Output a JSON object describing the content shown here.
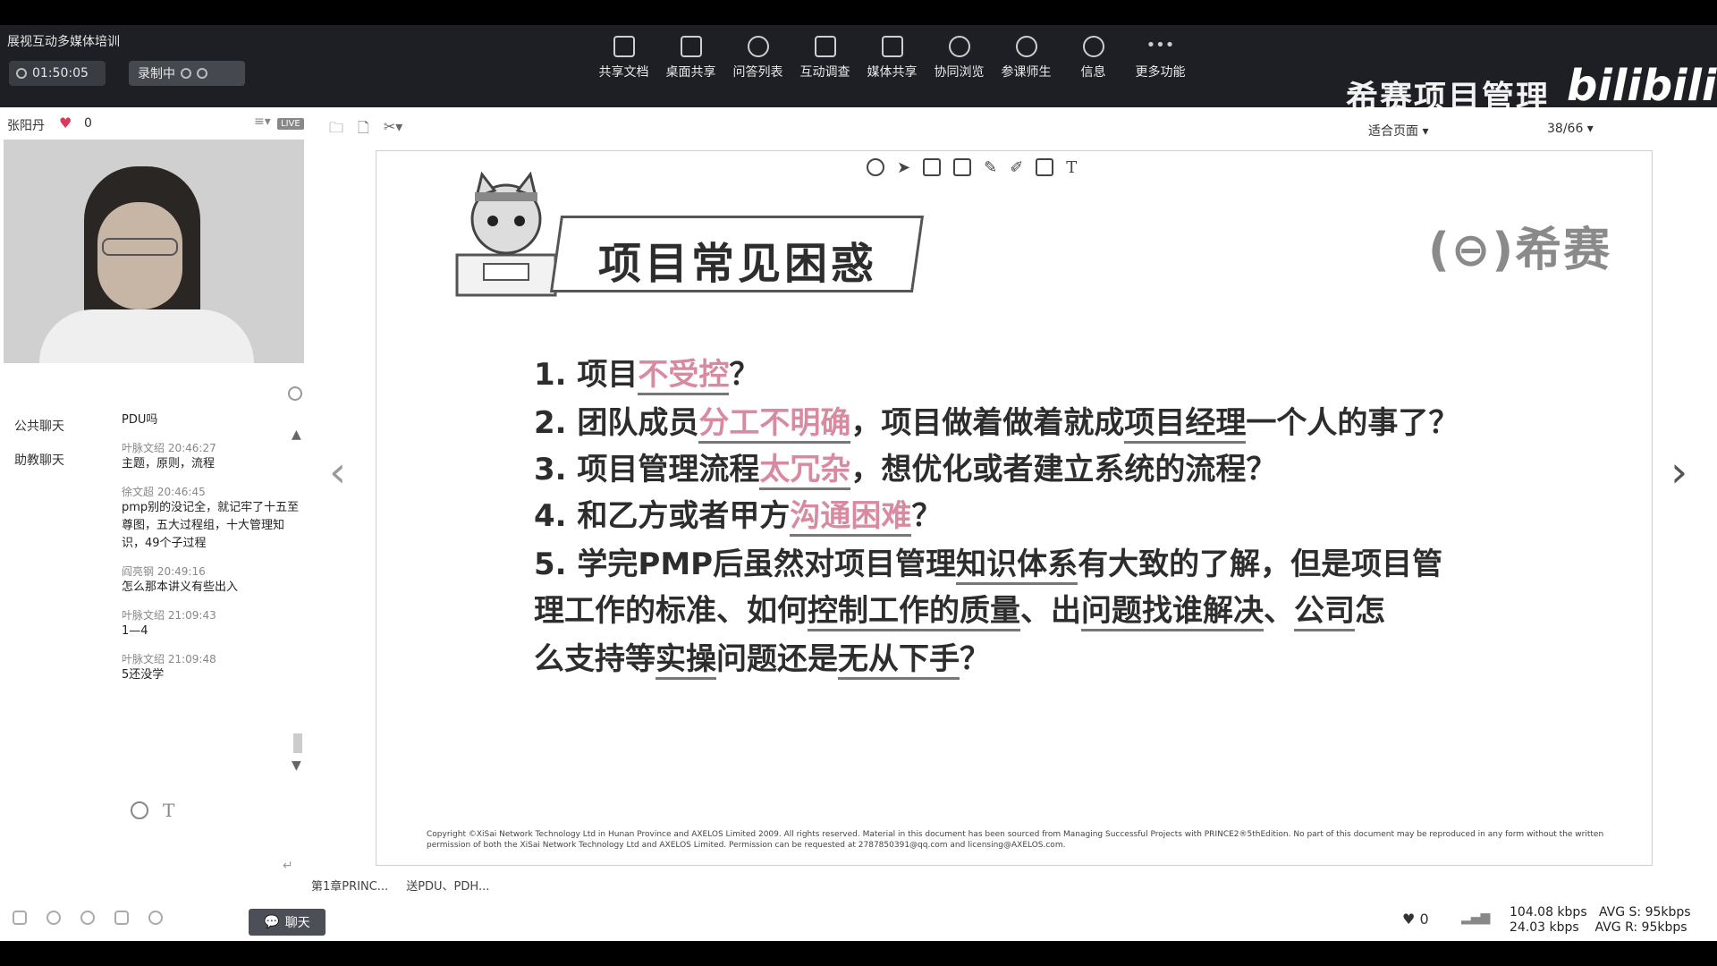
{
  "app": {
    "title": "展视互动多媒体培训",
    "timer": "01:50:05",
    "recording_label": "录制中"
  },
  "toolbar": {
    "items": [
      {
        "label": "共享文档"
      },
      {
        "label": "桌面共享"
      },
      {
        "label": "问答列表"
      },
      {
        "label": "互动调查"
      },
      {
        "label": "媒体共享"
      },
      {
        "label": "协同浏览"
      },
      {
        "label": "参课师生"
      },
      {
        "label": "信息"
      },
      {
        "label": "更多功能"
      }
    ]
  },
  "brand": {
    "text": "希赛项目管理",
    "logo_text": "bilibili"
  },
  "presenter": {
    "name": "张阳丹",
    "likes": "0",
    "live_badge": "LIVE"
  },
  "chat": {
    "tabs": [
      "公共聊天",
      "助教聊天"
    ],
    "messages": [
      {
        "meta": "",
        "text": "PDU吗"
      },
      {
        "meta": "叶脉文绍 20:46:27",
        "text": "主题，原则，流程"
      },
      {
        "meta": "徐文超 20:46:45",
        "text": "pmp别的没记全，就记牢了十五至尊图，五大过程组，十大管理知识，49个子过程"
      },
      {
        "meta": "阎亮钢 20:49:16",
        "text": "怎么那本讲义有些出入"
      },
      {
        "meta": "叶脉文绍 21:09:43",
        "text": "1—4"
      },
      {
        "meta": "叶脉文绍 21:09:48",
        "text": "5还没学"
      }
    ],
    "chat_button": "聊天"
  },
  "document": {
    "fit_label": "适合页面",
    "page_indicator": "38/66",
    "bottom_tabs": [
      "第1章PRINC...",
      "送PDU、PDH..."
    ]
  },
  "slide": {
    "title": "项目常见困惑",
    "logo": "(⊖)希赛",
    "questions": [
      {
        "parts": [
          {
            "t": "1. 项目"
          },
          {
            "t": "不受控",
            "hl": true
          },
          {
            "t": "？"
          }
        ]
      },
      {
        "parts": [
          {
            "t": "2. 团队成员"
          },
          {
            "t": "分工不明确",
            "hl": true
          },
          {
            "t": "，项目做着做着就成"
          },
          {
            "t": "项目经理",
            "ul": true
          },
          {
            "t": "一个人的事了？"
          }
        ]
      },
      {
        "parts": [
          {
            "t": "3. 项目管理流程"
          },
          {
            "t": "太冗杂",
            "hl": true
          },
          {
            "t": "，想优化或者建立系统的流程？"
          }
        ]
      },
      {
        "parts": [
          {
            "t": "4. 和乙方或者甲方"
          },
          {
            "t": "沟通困难",
            "hl": true
          },
          {
            "t": "？"
          }
        ]
      },
      {
        "parts": [
          {
            "t": "5. 学完PMP后虽然对项目管理"
          },
          {
            "t": "知识体系",
            "ul": true
          },
          {
            "t": "有大致的了解，但是项目管"
          }
        ]
      },
      {
        "parts": [
          {
            "t": "   理工作的标准、如何"
          },
          {
            "t": "控制工作的质量",
            "ul": true
          },
          {
            "t": "、出"
          },
          {
            "t": "问题找谁解决",
            "ul": true
          },
          {
            "t": "、"
          },
          {
            "t": "公司",
            "ul": true
          },
          {
            "t": "怎"
          }
        ]
      },
      {
        "parts": [
          {
            "t": "   么支持等"
          },
          {
            "t": "实操",
            "ul": true
          },
          {
            "t": "问题还是"
          },
          {
            "t": "无从下手",
            "ul": true
          },
          {
            "t": "？"
          }
        ]
      }
    ],
    "copyright": "Copyright ©XiSai Network Technology Ltd in Hunan Province and AXELOS Limited 2009. All rights reserved. Material in this document has been sourced from Managing Successful Projects with PRINCE2®5thEdition. No part of this document may be reproduced in any form without the written permission of both the XiSai Network Technology Ltd and AXELOS Limited. Permission can be requested at 2787850391@qq.com and licensing@AXELOS.com."
  },
  "stats": {
    "likes": "0",
    "up_rate": "104.08 kbps",
    "down_rate": "24.03 kbps",
    "avg_s": "AVG S: 95kbps",
    "avg_r": "AVG R: 95kbps"
  },
  "colors": {
    "highlight": "#d88aa0",
    "toolbar_bg": "#1e1f24"
  }
}
